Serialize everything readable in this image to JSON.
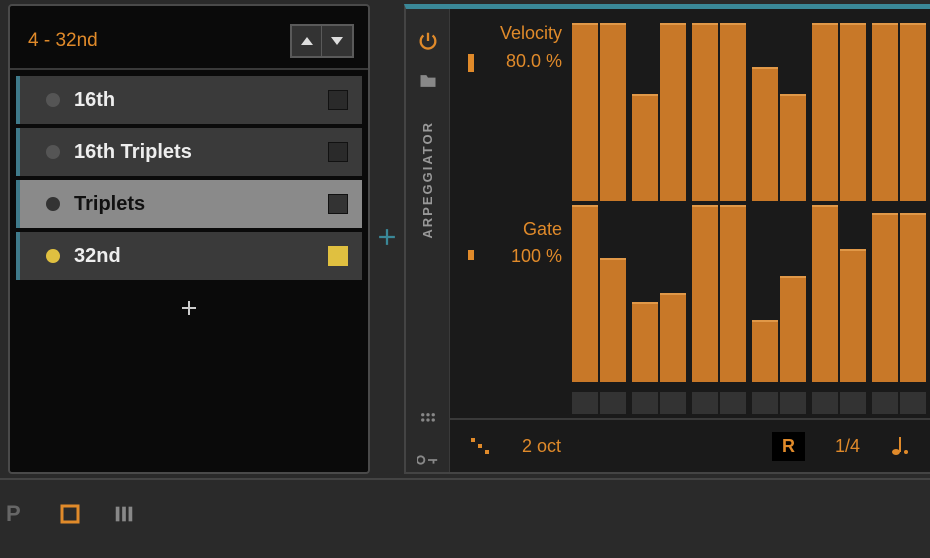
{
  "dropdown": {
    "selected_label": "4 - 32nd"
  },
  "list": {
    "items": [
      {
        "label": "16th",
        "active": false,
        "highlight": false
      },
      {
        "label": "16th Triplets",
        "active": false,
        "highlight": false
      },
      {
        "label": "Triplets",
        "active": false,
        "highlight": true
      },
      {
        "label": "32nd",
        "active": true,
        "highlight": false
      }
    ]
  },
  "device": {
    "title": "ARPEGGIATOR"
  },
  "velocity": {
    "label": "Velocity",
    "value": "80.0 %"
  },
  "gate": {
    "label": "Gate",
    "value": "100 %"
  },
  "chart_data": {
    "type": "bar",
    "tracks": [
      {
        "name": "Velocity",
        "pairs": [
          [
            100,
            100
          ],
          [
            60,
            100
          ],
          [
            100,
            100
          ],
          [
            75,
            60
          ],
          [
            100,
            100
          ],
          [
            100,
            100
          ]
        ]
      },
      {
        "name": "Gate",
        "pairs": [
          [
            100,
            70
          ],
          [
            45,
            50
          ],
          [
            100,
            100
          ],
          [
            35,
            60
          ],
          [
            100,
            75
          ],
          [
            95,
            95
          ]
        ]
      }
    ],
    "ylim": [
      0,
      100
    ]
  },
  "params": {
    "octaves": "2 oct",
    "mode": "R",
    "rate": "1/4"
  }
}
